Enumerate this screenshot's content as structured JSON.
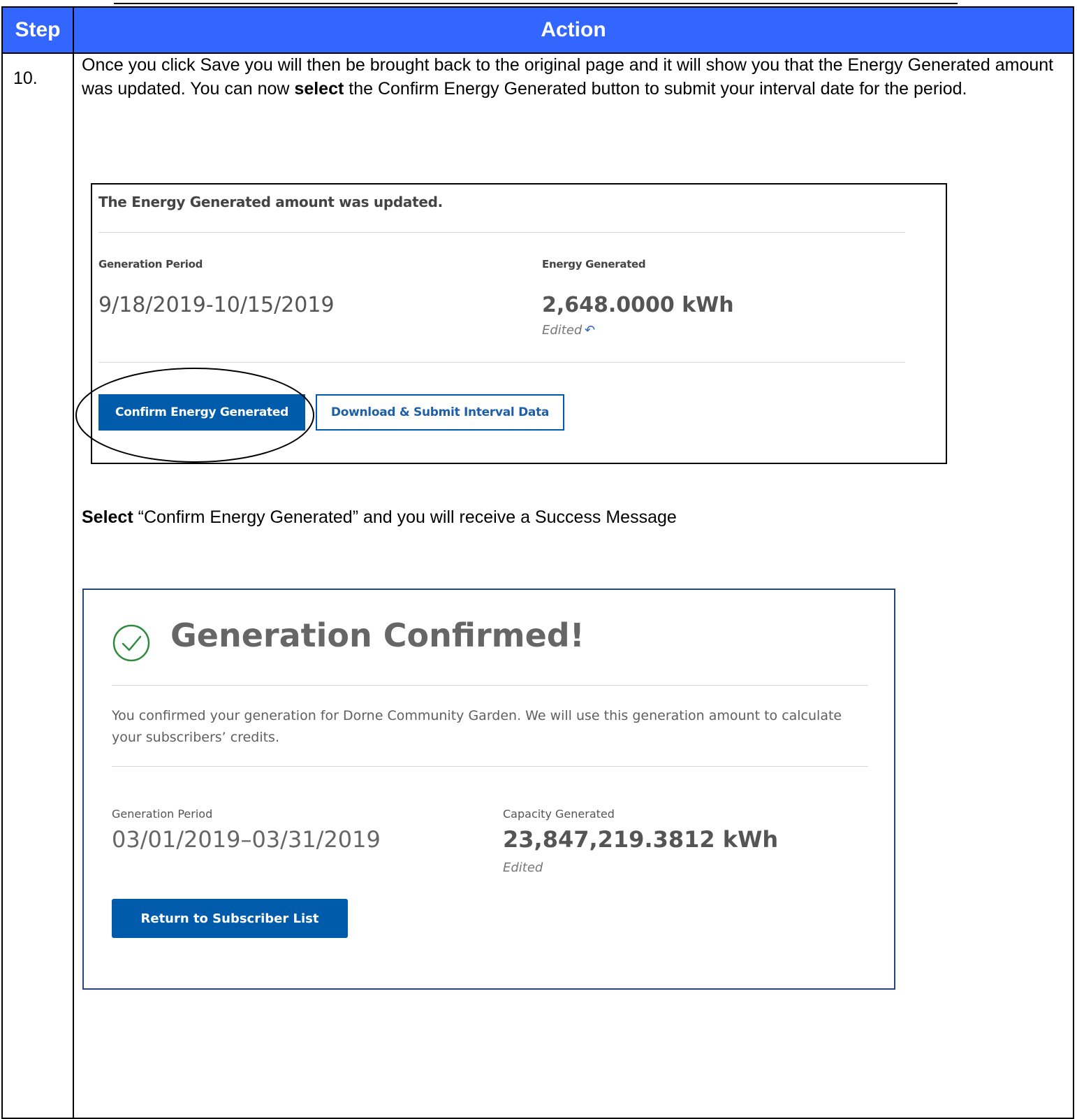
{
  "table": {
    "header": {
      "step": "Step",
      "action": "Action"
    },
    "step_number": "10.",
    "intro": {
      "part1": "Once you click Save you will then be brought back to the original page and it will show you that the Energy Generated amount was updated.  You can now ",
      "bold": "select",
      "part2": " the Confirm Energy Generated button to submit your interval date for the period."
    }
  },
  "screenshot1": {
    "updated_message": "The Energy Generated amount was updated.",
    "generation_period_label": "Generation Period",
    "generation_period_value": "9/18/2019-10/15/2019",
    "energy_generated_label": "Energy Generated",
    "energy_generated_value": "2,648.0000 kWh",
    "edited_label": "Edited",
    "undo_icon": "undo-icon",
    "confirm_button": "Confirm Energy Generated",
    "download_button": "Download & Submit Interval Data"
  },
  "select_instruction": {
    "bold": "Select",
    "rest": " “Confirm Energy Generated” and you will receive a Success Message"
  },
  "screenshot2": {
    "check_icon": "check-circle-icon",
    "title": "Generation Confirmed!",
    "message": "You confirmed your generation for Dorne Community Garden. We will use this generation amount to calculate your subscribers’ credits.",
    "generation_period_label": "Generation Period",
    "generation_period_value": "03/01/2019–03/31/2019",
    "capacity_label": "Capacity Generated",
    "capacity_value": "23,847,219.3812 kWh",
    "edited_label": "Edited",
    "return_button": "Return to Subscriber List"
  },
  "colors": {
    "header_blue": "#3366ff",
    "button_blue": "#005bab",
    "success_green": "#2e8b3e"
  }
}
